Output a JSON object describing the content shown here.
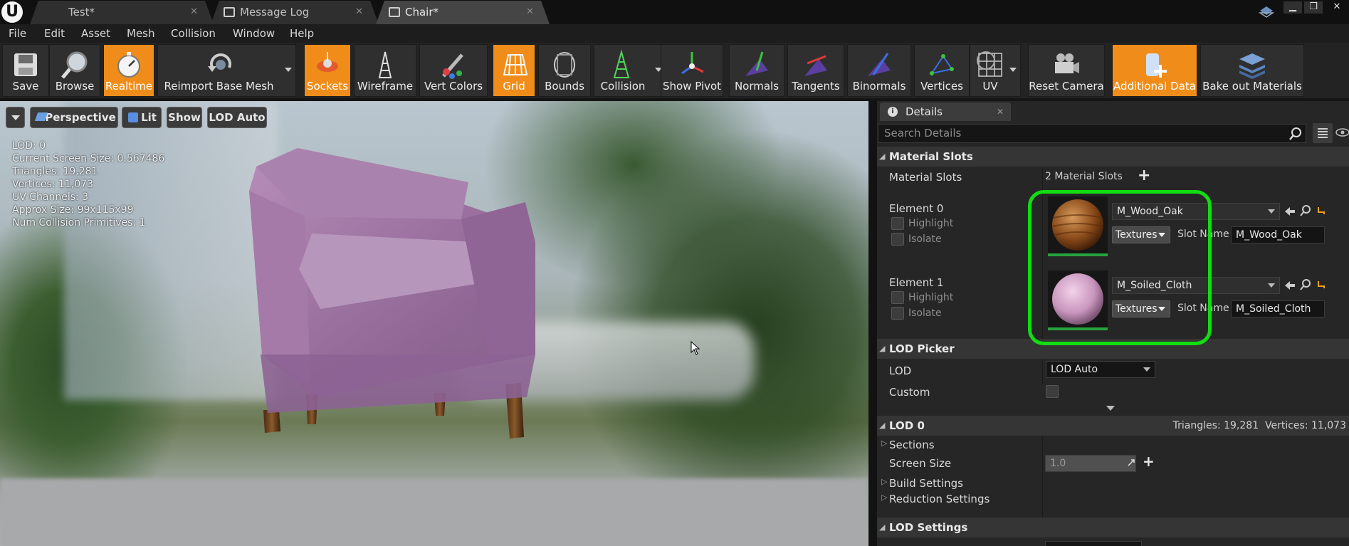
{
  "titlebar": {
    "tabs": [
      {
        "label": "Test*",
        "icon": "ue-logo-icon"
      },
      {
        "label": "Message Log",
        "icon": "message-log-icon"
      },
      {
        "label": "Chair*",
        "icon": "static-mesh-icon"
      }
    ],
    "window_controls": {
      "minimize": "▁",
      "maximize": "❐",
      "close": "✕"
    }
  },
  "menu": [
    "File",
    "Edit",
    "Asset",
    "Mesh",
    "Collision",
    "Window",
    "Help"
  ],
  "toolbar": [
    {
      "label": "Save",
      "active": false,
      "icon": "save-icon"
    },
    {
      "label": "Browse",
      "active": false,
      "icon": "browse-icon"
    },
    {
      "label": "Realtime",
      "active": true,
      "icon": "realtime-icon"
    },
    {
      "label": "Reimport Base Mesh",
      "active": false,
      "icon": "reimport-icon",
      "dropdown": true
    },
    {
      "label": "Sockets",
      "active": true,
      "icon": "sockets-icon"
    },
    {
      "label": "Wireframe",
      "active": false,
      "icon": "wireframe-icon"
    },
    {
      "label": "Vert Colors",
      "active": false,
      "icon": "vert-colors-icon"
    },
    {
      "label": "Grid",
      "active": true,
      "icon": "grid-icon"
    },
    {
      "label": "Bounds",
      "active": false,
      "icon": "bounds-icon"
    },
    {
      "label": "Collision",
      "active": false,
      "icon": "collision-icon",
      "dropdown": true
    },
    {
      "label": "Show Pivot",
      "active": false,
      "icon": "pivot-icon"
    },
    {
      "label": "Normals",
      "active": false,
      "icon": "normals-icon"
    },
    {
      "label": "Tangents",
      "active": false,
      "icon": "tangents-icon"
    },
    {
      "label": "Binormals",
      "active": false,
      "icon": "binormals-icon"
    },
    {
      "label": "Vertices",
      "active": false,
      "icon": "vertices-icon"
    },
    {
      "label": "UV",
      "active": false,
      "icon": "uv-icon",
      "dropdown": true
    },
    {
      "label": "Reset Camera",
      "active": false,
      "icon": "camera-icon"
    },
    {
      "label": "Additional Data",
      "active": true,
      "icon": "additional-data-icon"
    },
    {
      "label": "Bake out Materials",
      "active": false,
      "icon": "bake-materials-icon"
    }
  ],
  "viewport": {
    "perspective": "Perspective",
    "lit": "Lit",
    "show": "Show",
    "lod": "LOD Auto",
    "stats": [
      "LOD:  0",
      "Current Screen Size:  0.567486",
      "Triangles:  19,281",
      "Vertices:  11,073",
      "UV Channels:  3",
      "Approx Size: 99x115x99",
      "Num Collision Primitives:  1"
    ]
  },
  "details": {
    "tab": "Details",
    "search_placeholder": "Search Details",
    "material_slots": {
      "header": "Material Slots",
      "label": "Material Slots",
      "count": "2 Material Slots",
      "elements": [
        {
          "label": "Element 0",
          "highlight": "Highlight",
          "isolate": "Isolate",
          "material": "M_Wood_Oak",
          "textures": "Textures",
          "slot_name_label": "Slot Name",
          "slot_name": "M_Wood_Oak",
          "thumb_color": "#8a4a1a"
        },
        {
          "label": "Element 1",
          "highlight": "Highlight",
          "isolate": "Isolate",
          "material": "M_Soiled_Cloth",
          "textures": "Textures",
          "slot_name_label": "Slot Name",
          "slot_name": "M_Soiled_Cloth",
          "thumb_color": "#d9a8cc"
        }
      ]
    },
    "lod_picker": {
      "header": "LOD Picker",
      "lod_label": "LOD",
      "lod_value": "LOD Auto",
      "custom_label": "Custom"
    },
    "lod0": {
      "header": "LOD 0",
      "summary": "Triangles: 19,281  Vertices: 11,073",
      "sections": "Sections",
      "screen_size_label": "Screen Size",
      "screen_size_value": "1.0",
      "build_settings": "Build Settings",
      "reduction_settings": "Reduction Settings"
    },
    "lod_settings": {
      "header": "LOD Settings"
    }
  },
  "colors": {
    "accent": "#f08d1a",
    "highlight_ring": "#11dd11",
    "panel": "#262626"
  }
}
